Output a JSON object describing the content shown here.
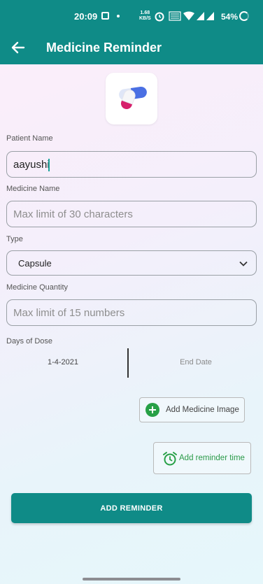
{
  "status_bar": {
    "time": "20:09",
    "net_speed_value": "1.68",
    "net_speed_unit": "KB/S",
    "battery": "54%"
  },
  "app_bar": {
    "title": "Medicine Reminder",
    "back_icon": "arrow-left-icon"
  },
  "logo": {
    "icon": "capsule-pill-icon"
  },
  "form": {
    "patient_name": {
      "label": "Patient Name",
      "value": "aayushi"
    },
    "medicine_name": {
      "label": "Medicine Name",
      "value": "",
      "placeholder": "Max limit of 30 characters"
    },
    "type": {
      "label": "Type",
      "selected": "Capsule"
    },
    "quantity": {
      "label": "Medicine Quantity",
      "value": "",
      "placeholder": "Max limit of 15 numbers"
    },
    "days_of_dose": {
      "label": "Days of Dose",
      "start_date": "1-4-2021",
      "end_date": "End Date"
    }
  },
  "buttons": {
    "add_image": "Add Medicine Image",
    "add_time": "Add reminder time",
    "submit": "ADD REMINDER"
  },
  "colors": {
    "primary": "#0f8b87",
    "green_accent": "#27a046"
  }
}
